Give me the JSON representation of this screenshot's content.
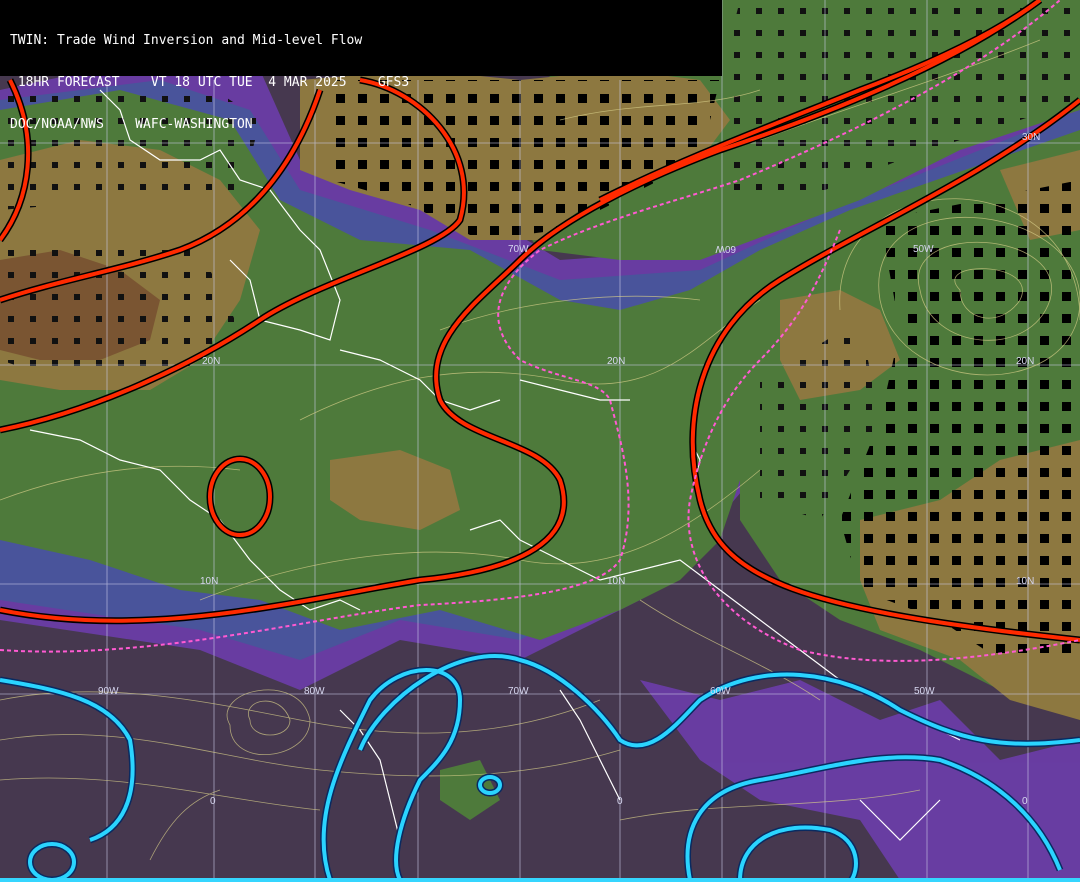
{
  "header": {
    "line1": "TWIN: Trade Wind Inversion and Mid-level Flow",
    "line2": " 18HR FORECAST    VT 18 UTC TUE  4 MAR 2025    GFS3",
    "line3": "DOC/NOAA/NWS    WAFC-WASHINGTON"
  },
  "grid_labels": [
    {
      "t": "70W"
    },
    {
      "t": "60W"
    },
    {
      "t": "50W"
    },
    {
      "t": "30N"
    },
    {
      "t": "20N"
    },
    {
      "t": "20N"
    },
    {
      "t": "20N"
    },
    {
      "t": "10N"
    },
    {
      "t": "10N"
    },
    {
      "t": "10N"
    },
    {
      "t": "90W"
    },
    {
      "t": "80W"
    },
    {
      "t": "70W"
    },
    {
      "t": "60W"
    },
    {
      "t": "50W"
    },
    {
      "t": "0"
    },
    {
      "t": "0"
    },
    {
      "t": "0"
    }
  ],
  "colors": {
    "background_dark": "#46384f",
    "green_layer": "#4f7a3c",
    "tan_layer": "#8f7a3e",
    "brown_layer": "#7a5532",
    "purple_layer": "#7a3fb0",
    "blue_layer": "#4c5aa0",
    "red_contour": "#ff2a00",
    "pink_dashed": "#ff5ad2",
    "cyan_contour": "#2ad4ff",
    "streamline": "#d9d08a",
    "coastline": "#ffffff",
    "grid": "#c9c9e6"
  }
}
